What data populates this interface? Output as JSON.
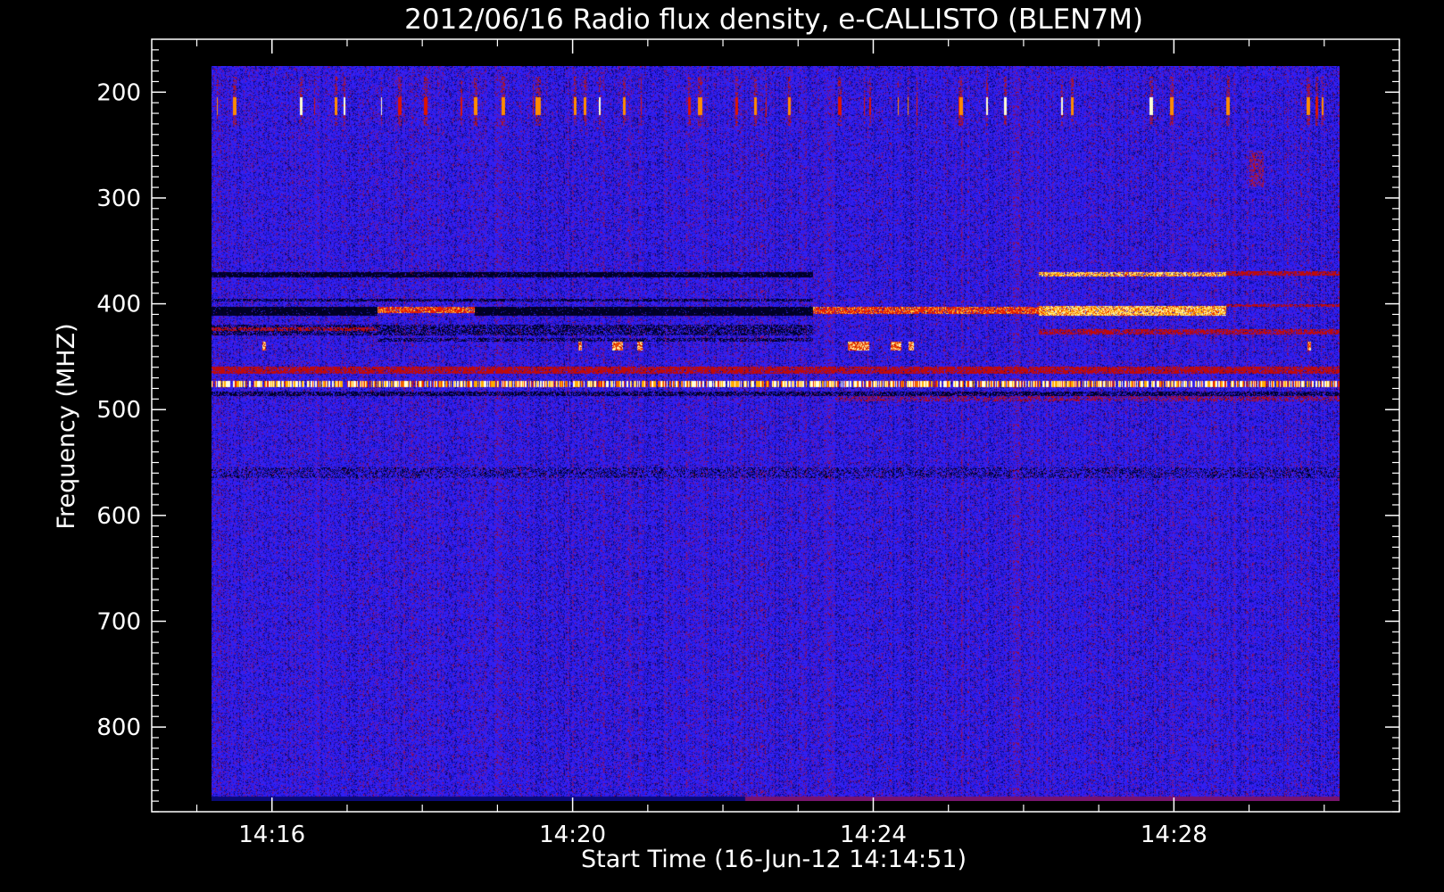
{
  "chart_data": {
    "type": "heatmap",
    "title": "2012/06/16  Radio flux density, e-CALLISTO (BLEN7M)",
    "xlabel": "Start Time (16-Jun-12 14:14:51)",
    "ylabel": "Frequency (MHZ)",
    "x_ticks": [
      "14:16",
      "14:20",
      "14:24",
      "14:28"
    ],
    "y_ticks": [
      "200",
      "300",
      "400",
      "500",
      "600",
      "700",
      "800"
    ],
    "y_tick_values": [
      200,
      300,
      400,
      500,
      600,
      700,
      800
    ],
    "x_tick_minutes": [
      16,
      20,
      24,
      28
    ],
    "xlim_minutes": [
      14.4,
      31.0
    ],
    "ylim": [
      880,
      150
    ],
    "data_time_range_minutes": [
      15.2,
      30.2
    ],
    "data_freq_range": [
      175,
      870
    ],
    "background_color": "#2a1ff0",
    "colormap": [
      "#000000",
      "#1010c0",
      "#2a1ff0",
      "#b00000",
      "#ff2000",
      "#ffb000",
      "#ffffff"
    ],
    "features": [
      {
        "kind": "burst-band",
        "freq": [
          200,
          225
        ],
        "note": "intermittent vertical spikes"
      },
      {
        "kind": "band",
        "freq": [
          370,
          374
        ],
        "t": [
          26.2,
          28.7
        ],
        "level": "high"
      },
      {
        "kind": "band",
        "freq": [
          403,
          410
        ],
        "t": [
          23.2,
          28.7
        ],
        "level": "very-high"
      },
      {
        "kind": "band",
        "freq": [
          461,
          465
        ],
        "t": [
          15.2,
          30.2
        ],
        "level": "high"
      },
      {
        "kind": "band",
        "freq": [
          474,
          478
        ],
        "t": [
          15.2,
          30.2
        ],
        "level": "very-high"
      },
      {
        "kind": "band",
        "freq": [
          487,
          492
        ],
        "t": [
          15.2,
          30.2
        ],
        "level": "medium"
      }
    ]
  }
}
